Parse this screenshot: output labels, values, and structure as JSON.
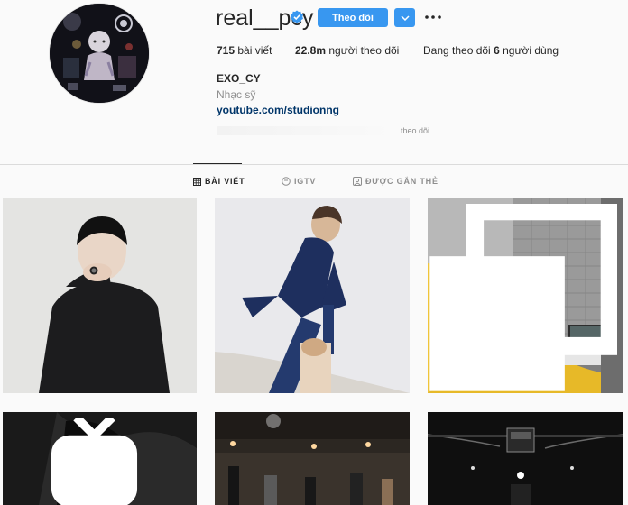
{
  "profile": {
    "username": "real__pcy",
    "follow_label": "Theo dõi",
    "posts_count": "715",
    "posts_label": "bài viết",
    "followers_count": "22.8m",
    "followers_label": "người theo dõi",
    "following_prefix": "Đang theo dõi",
    "following_count": "6",
    "following_suffix": "người dùng",
    "full_name": "EXO_CY",
    "category": "Nhạc sỹ",
    "link": "youtube.com/studionng",
    "followed_by_suffix": "theo dõi"
  },
  "icons": {
    "verified": "verified-badge-icon",
    "dropdown": "chevron-down-icon",
    "more": "more-options-icon",
    "posts_tab": "grid-icon",
    "igtv_tab": "igtv-icon",
    "tagged_tab": "tagged-icon",
    "multi_post": "carousel-icon",
    "video_post": "igtv-icon"
  },
  "tabs": [
    {
      "label": "BÀI VIẾT",
      "active": true
    },
    {
      "label": "IGTV",
      "active": false
    },
    {
      "label": "ĐƯỢC GẮN THẺ",
      "active": false
    }
  ],
  "colors": {
    "accent": "#3897f0",
    "link": "#003569",
    "text": "#262626",
    "muted": "#8e8e8e",
    "background": "#fafafa"
  }
}
